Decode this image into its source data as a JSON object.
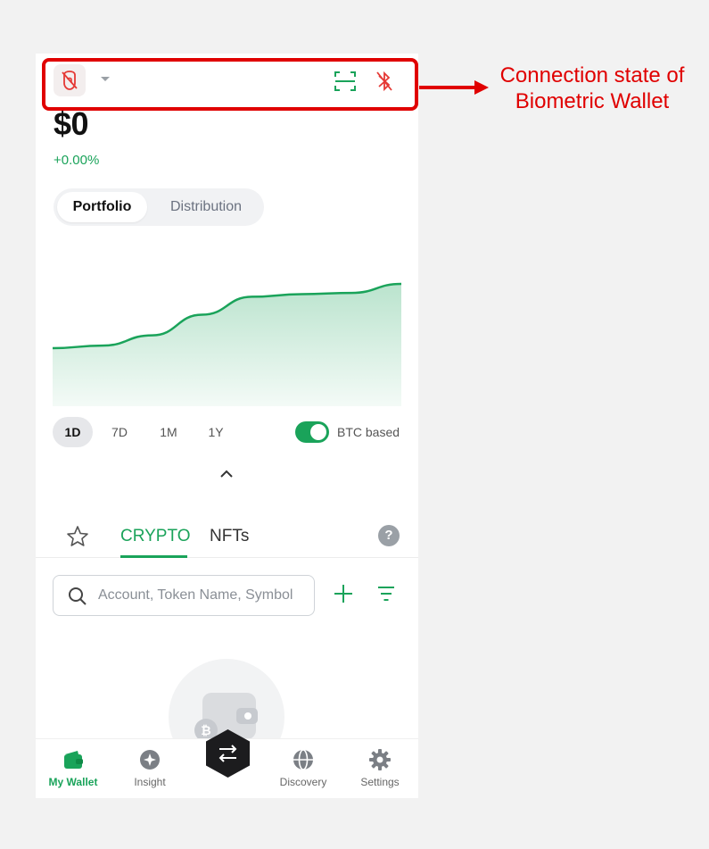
{
  "header": {
    "balance": "$0",
    "change": "+0.00%"
  },
  "view_toggle": {
    "active": "Portfolio",
    "inactive": "Distribution"
  },
  "chart_data": {
    "type": "area",
    "series": [
      {
        "values": [
          0.5,
          0.52,
          0.6,
          0.76,
          0.9,
          0.92,
          0.93,
          1.0
        ]
      }
    ],
    "color": "#1aa35a"
  },
  "ranges": {
    "items": [
      "1D",
      "7D",
      "1M",
      "1Y"
    ],
    "selected": "1D"
  },
  "btc_toggle": {
    "label": "BTC based",
    "on": true
  },
  "asset_tabs": {
    "crypto": "CRYPTO",
    "nfts": "NFTs",
    "help": "?"
  },
  "search": {
    "placeholder": "Account, Token Name, Symbol"
  },
  "bottom_nav": [
    {
      "label": "My Wallet",
      "icon": "wallet-icon",
      "active": true
    },
    {
      "label": "Insight",
      "icon": "insight-icon",
      "active": false
    },
    {
      "label": "Discovery",
      "icon": "globe-icon",
      "active": false
    },
    {
      "label": "Settings",
      "icon": "gear-icon",
      "active": false
    }
  ],
  "annotation": {
    "line1": "Connection state of",
    "line2": "Biometric Wallet"
  },
  "colors": {
    "accent": "#1aa35a",
    "alert": "#e53935",
    "annotation": "#e00000"
  }
}
